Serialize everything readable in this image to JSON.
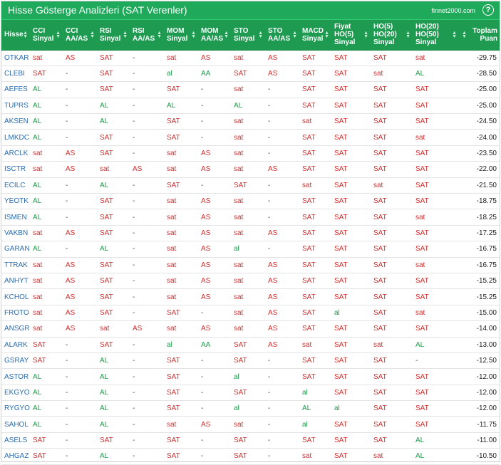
{
  "window": {
    "title": "Hisse Gösterge Analizleri (SAT Verenler)",
    "site": "finnet2000.com",
    "help": "?"
  },
  "colors": {
    "header": "#1ea95b",
    "red": "#d12d2d",
    "green": "#1e9b4a",
    "link": "#2a6cb0"
  },
  "columns": [
    {
      "key": "hisse",
      "lines": [
        "Hisse"
      ]
    },
    {
      "key": "cci_sinyal",
      "lines": [
        "CCI",
        "Sinyal"
      ]
    },
    {
      "key": "cci_aaas",
      "lines": [
        "CCI",
        "AA/AS"
      ]
    },
    {
      "key": "rsi_sinyal",
      "lines": [
        "RSI",
        "Sinyal"
      ]
    },
    {
      "key": "rsi_aaas",
      "lines": [
        "RSI",
        "AA/AS"
      ]
    },
    {
      "key": "mom_sinyal",
      "lines": [
        "MOM",
        "Sinyal"
      ]
    },
    {
      "key": "mom_aaas",
      "lines": [
        "MOM",
        "AA/AS"
      ]
    },
    {
      "key": "sto_sinyal",
      "lines": [
        "STO",
        "Sinyal"
      ]
    },
    {
      "key": "sto_aaas",
      "lines": [
        "STO",
        "AA/AS"
      ]
    },
    {
      "key": "macd_sinyal",
      "lines": [
        "MACD",
        "Sinyal"
      ]
    },
    {
      "key": "fiyat_ho5",
      "lines": [
        "Fiyat",
        "HO(5)",
        "Sinyal"
      ]
    },
    {
      "key": "ho5_ho20",
      "lines": [
        "HO(5)",
        "HO(20)",
        "Sinyal"
      ]
    },
    {
      "key": "ho20_ho50",
      "lines": [
        "HO(20)",
        "HO(50)",
        "Sinyal"
      ]
    },
    {
      "key": "toplam_puan",
      "lines": [
        "Toplam",
        "Puan"
      ]
    }
  ],
  "rows": [
    [
      "OTKAR",
      "sat",
      "AS",
      "SAT",
      "-",
      "sat",
      "AS",
      "sat",
      "AS",
      "SAT",
      "SAT",
      "SAT",
      "sat",
      "-29.75"
    ],
    [
      "CLEBI",
      "SAT",
      "-",
      "SAT",
      "-",
      "al",
      "AA",
      "SAT",
      "AS",
      "SAT",
      "SAT",
      "sat",
      "AL",
      "-28.50"
    ],
    [
      "AEFES",
      "AL",
      "-",
      "SAT",
      "-",
      "SAT",
      "-",
      "sat",
      "-",
      "SAT",
      "SAT",
      "SAT",
      "SAT",
      "-25.00"
    ],
    [
      "TUPRS",
      "AL",
      "-",
      "AL",
      "-",
      "AL",
      "-",
      "AL",
      "-",
      "SAT",
      "SAT",
      "SAT",
      "SAT",
      "-25.00"
    ],
    [
      "AKSEN",
      "AL",
      "-",
      "AL",
      "-",
      "SAT",
      "-",
      "sat",
      "-",
      "sat",
      "SAT",
      "SAT",
      "SAT",
      "-24.50"
    ],
    [
      "LMKDC",
      "AL",
      "-",
      "SAT",
      "-",
      "SAT",
      "-",
      "sat",
      "-",
      "SAT",
      "SAT",
      "SAT",
      "sat",
      "-24.00"
    ],
    [
      "ARCLK",
      "sat",
      "AS",
      "SAT",
      "-",
      "sat",
      "AS",
      "sat",
      "-",
      "SAT",
      "SAT",
      "SAT",
      "SAT",
      "-23.50"
    ],
    [
      "ISCTR",
      "sat",
      "AS",
      "sat",
      "AS",
      "sat",
      "AS",
      "sat",
      "AS",
      "SAT",
      "SAT",
      "SAT",
      "SAT",
      "-22.00"
    ],
    [
      "ECILC",
      "AL",
      "-",
      "AL",
      "-",
      "SAT",
      "-",
      "SAT",
      "-",
      "sat",
      "SAT",
      "sat",
      "SAT",
      "-21.50"
    ],
    [
      "YEOTK",
      "AL",
      "-",
      "SAT",
      "-",
      "sat",
      "AS",
      "sat",
      "-",
      "SAT",
      "SAT",
      "SAT",
      "SAT",
      "-18.75"
    ],
    [
      "ISMEN",
      "AL",
      "-",
      "SAT",
      "-",
      "sat",
      "AS",
      "sat",
      "-",
      "SAT",
      "SAT",
      "SAT",
      "sat",
      "-18.25"
    ],
    [
      "VAKBN",
      "sat",
      "AS",
      "SAT",
      "-",
      "sat",
      "AS",
      "sat",
      "AS",
      "SAT",
      "SAT",
      "SAT",
      "SAT",
      "-17.25"
    ],
    [
      "GARAN",
      "AL",
      "-",
      "AL",
      "-",
      "sat",
      "AS",
      "al",
      "-",
      "SAT",
      "SAT",
      "SAT",
      "SAT",
      "-16.75"
    ],
    [
      "TTRAK",
      "sat",
      "AS",
      "SAT",
      "-",
      "sat",
      "AS",
      "sat",
      "AS",
      "SAT",
      "SAT",
      "SAT",
      "sat",
      "-16.75"
    ],
    [
      "ANHYT",
      "sat",
      "AS",
      "SAT",
      "-",
      "sat",
      "AS",
      "sat",
      "AS",
      "SAT",
      "SAT",
      "SAT",
      "SAT",
      "-15.25"
    ],
    [
      "KCHOL",
      "sat",
      "AS",
      "SAT",
      "-",
      "sat",
      "AS",
      "sat",
      "AS",
      "SAT",
      "SAT",
      "SAT",
      "SAT",
      "-15.25"
    ],
    [
      "FROTO",
      "sat",
      "AS",
      "SAT",
      "-",
      "SAT",
      "-",
      "sat",
      "AS",
      "SAT",
      "al",
      "SAT",
      "sat",
      "-15.00"
    ],
    [
      "ANSGR",
      "sat",
      "AS",
      "sat",
      "AS",
      "sat",
      "AS",
      "sat",
      "AS",
      "SAT",
      "SAT",
      "SAT",
      "SAT",
      "-14.00"
    ],
    [
      "ALARK",
      "SAT",
      "-",
      "SAT",
      "-",
      "al",
      "AA",
      "SAT",
      "AS",
      "sat",
      "SAT",
      "sat",
      "AL",
      "-13.00"
    ],
    [
      "GSRAY",
      "SAT",
      "-",
      "AL",
      "-",
      "SAT",
      "-",
      "SAT",
      "-",
      "SAT",
      "SAT",
      "SAT",
      "-",
      "-12.50"
    ],
    [
      "ASTOR",
      "AL",
      "-",
      "AL",
      "-",
      "SAT",
      "-",
      "al",
      "-",
      "SAT",
      "SAT",
      "SAT",
      "SAT",
      "-12.00"
    ],
    [
      "EKGYO",
      "AL",
      "-",
      "AL",
      "-",
      "SAT",
      "-",
      "SAT",
      "-",
      "al",
      "SAT",
      "SAT",
      "SAT",
      "-12.00"
    ],
    [
      "RYGYO",
      "AL",
      "-",
      "AL",
      "-",
      "SAT",
      "-",
      "al",
      "-",
      "AL",
      "al",
      "SAT",
      "SAT",
      "-12.00"
    ],
    [
      "SAHOL",
      "AL",
      "-",
      "AL",
      "-",
      "sat",
      "AS",
      "sat",
      "-",
      "al",
      "SAT",
      "SAT",
      "SAT",
      "-11.75"
    ],
    [
      "ASELS",
      "SAT",
      "-",
      "SAT",
      "-",
      "SAT",
      "-",
      "SAT",
      "-",
      "SAT",
      "SAT",
      "SAT",
      "AL",
      "-11.00"
    ],
    [
      "AHGAZ",
      "SAT",
      "-",
      "AL",
      "-",
      "SAT",
      "-",
      "SAT",
      "-",
      "sat",
      "SAT",
      "sat",
      "AL",
      "-10.50"
    ]
  ]
}
